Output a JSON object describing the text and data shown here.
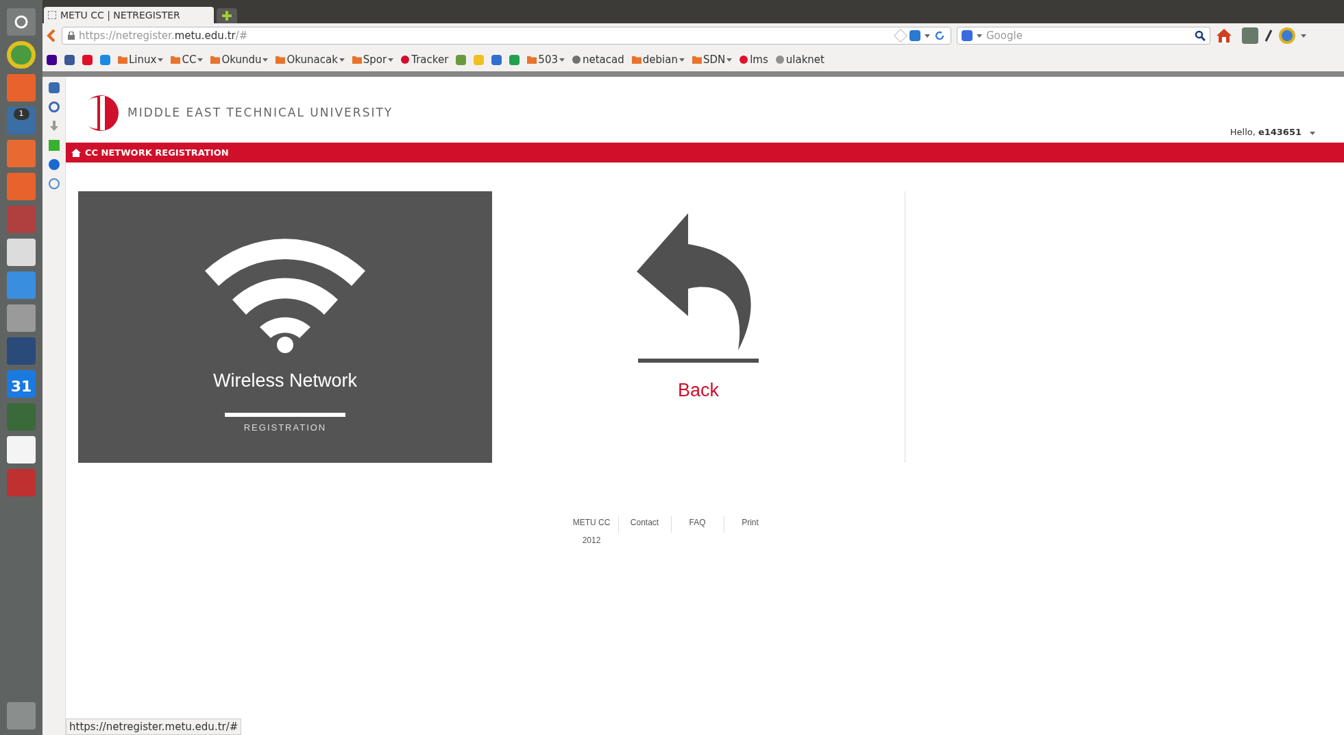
{
  "browser": {
    "tab_title": "METU CC | NETREGISTER",
    "url": {
      "scheme": "https://netregister.",
      "domain": "metu.edu.tr",
      "path": "/#"
    },
    "search_placeholder": "Google"
  },
  "launcher": {
    "mail_badge": "1",
    "calendar_day": "31"
  },
  "bookmarks": [
    {
      "kind": "icon",
      "color": "#400090"
    },
    {
      "kind": "icon",
      "color": "#3b5998"
    },
    {
      "kind": "icon",
      "color": "#e0102a"
    },
    {
      "kind": "icon",
      "color": "#1a8be0"
    },
    {
      "kind": "folder",
      "label": "Linux"
    },
    {
      "kind": "folder",
      "label": "CC"
    },
    {
      "kind": "folder",
      "label": "Okundu"
    },
    {
      "kind": "folder",
      "label": "Okunacak"
    },
    {
      "kind": "folder",
      "label": "Spor"
    },
    {
      "kind": "link",
      "label": "Tracker",
      "color": "#d0102a"
    },
    {
      "kind": "icon",
      "color": "#6a9a40"
    },
    {
      "kind": "icon",
      "color": "#f0c020"
    },
    {
      "kind": "icon",
      "color": "#3070d0"
    },
    {
      "kind": "icon",
      "color": "#20a050"
    },
    {
      "kind": "folder",
      "label": "503"
    },
    {
      "kind": "link",
      "label": "netacad",
      "color": "#707070"
    },
    {
      "kind": "folder",
      "label": "debian"
    },
    {
      "kind": "folder",
      "label": "SDN"
    },
    {
      "kind": "link",
      "label": "lms",
      "color": "#e0102a"
    },
    {
      "kind": "link",
      "label": "ulaknet",
      "color": "#909090"
    }
  ],
  "header": {
    "university": "MIDDLE EAST TECHNICAL UNIVERSITY",
    "greeting": "Hello,",
    "user": "e143651"
  },
  "nav": {
    "title": "CC NETWORK REGISTRATION"
  },
  "tiles": {
    "wireless": {
      "title": "Wireless Network",
      "subtitle": "REGISTRATION"
    },
    "back": {
      "label": "Back"
    }
  },
  "footer": {
    "items": [
      {
        "label": "METU CC",
        "sub": "2012"
      },
      {
        "label": "Contact"
      },
      {
        "label": "FAQ"
      },
      {
        "label": "Print"
      }
    ]
  },
  "status_bar": {
    "url": "https://netregister.metu.edu.tr/#"
  }
}
